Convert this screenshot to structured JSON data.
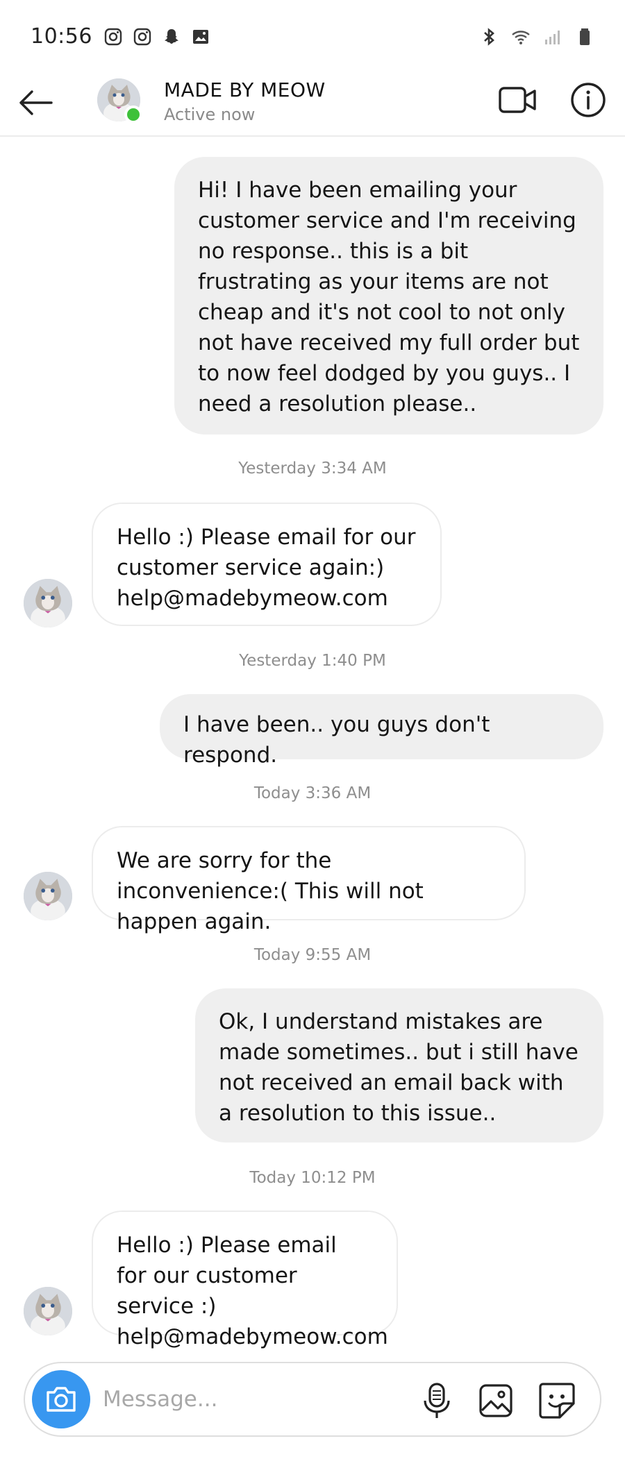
{
  "status_bar": {
    "time": "10:56",
    "left_icons": [
      "instagram-icon",
      "instagram-icon",
      "snapchat-icon",
      "gallery-icon"
    ],
    "right_icons": [
      "bluetooth-icon",
      "wifi-icon",
      "signal-icon",
      "battery-icon"
    ]
  },
  "header": {
    "contact_name": "MADE BY MEOW",
    "status": "Active now",
    "online_color": "#3ec13a"
  },
  "messages": [
    {
      "sender": "me",
      "text": "Hi! I have been emailing your customer service and I'm receiving no response.. this is a bit frustrating as your items are not cheap and it's not cool to not only not have received my full order but to now feel dodged by you guys.. I need a resolution please.."
    },
    {
      "timestamp": "Yesterday 3:34 AM"
    },
    {
      "sender": "them",
      "text": "Hello :) Please email for our customer service again:) help@madebymeow.com"
    },
    {
      "timestamp": "Yesterday 1:40 PM"
    },
    {
      "sender": "me",
      "text": "I have been.. you guys don't respond."
    },
    {
      "timestamp": "Today 3:36 AM"
    },
    {
      "sender": "them",
      "text": "We are sorry for the inconvenience:( This will not happen again."
    },
    {
      "timestamp": "Today 9:55 AM"
    },
    {
      "sender": "me",
      "text": "Ok, I understand mistakes are made sometimes.. but i still have not received an email back with a resolution to this issue.."
    },
    {
      "timestamp": "Today 10:12 PM"
    },
    {
      "sender": "them",
      "text": "Hello :) Please email for our customer service :) help@madebymeow.com"
    }
  ],
  "composer": {
    "placeholder": "Message...",
    "value": "",
    "accent_color": "#3897f0"
  }
}
